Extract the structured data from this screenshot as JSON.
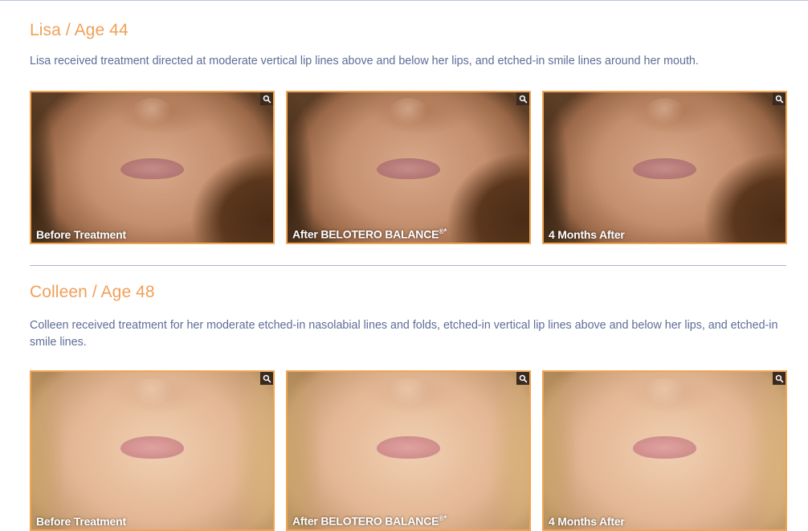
{
  "sections": [
    {
      "title": "Lisa / Age 44",
      "description": "Lisa received treatment directed at moderate vertical lip lines above and below her lips, and etched-in smile lines around her mouth.",
      "photos": [
        {
          "caption": "Before Treatment",
          "icon": "zoom-icon"
        },
        {
          "caption": "After BELOTERO BALANCE",
          "caption_sup": "®*",
          "icon": "zoom-icon"
        },
        {
          "caption": "4 Months After",
          "icon": "zoom-icon"
        }
      ]
    },
    {
      "title": "Colleen / Age 48",
      "description": "Colleen received treatment for her moderate etched-in nasolabial lines and folds, etched-in vertical lip lines above and below her lips, and etched-in smile lines.",
      "photos": [
        {
          "caption": "Before Treatment",
          "icon": "zoom-icon"
        },
        {
          "caption": "After BELOTERO BALANCE",
          "caption_sup": "®*",
          "icon": "zoom-icon"
        },
        {
          "caption": "4 Months After",
          "icon": "zoom-icon"
        }
      ]
    }
  ],
  "colors": {
    "title": "#f0a05a",
    "text": "#5e6d98",
    "photo_border": "#f0a552",
    "divider": "#aab4cc"
  }
}
